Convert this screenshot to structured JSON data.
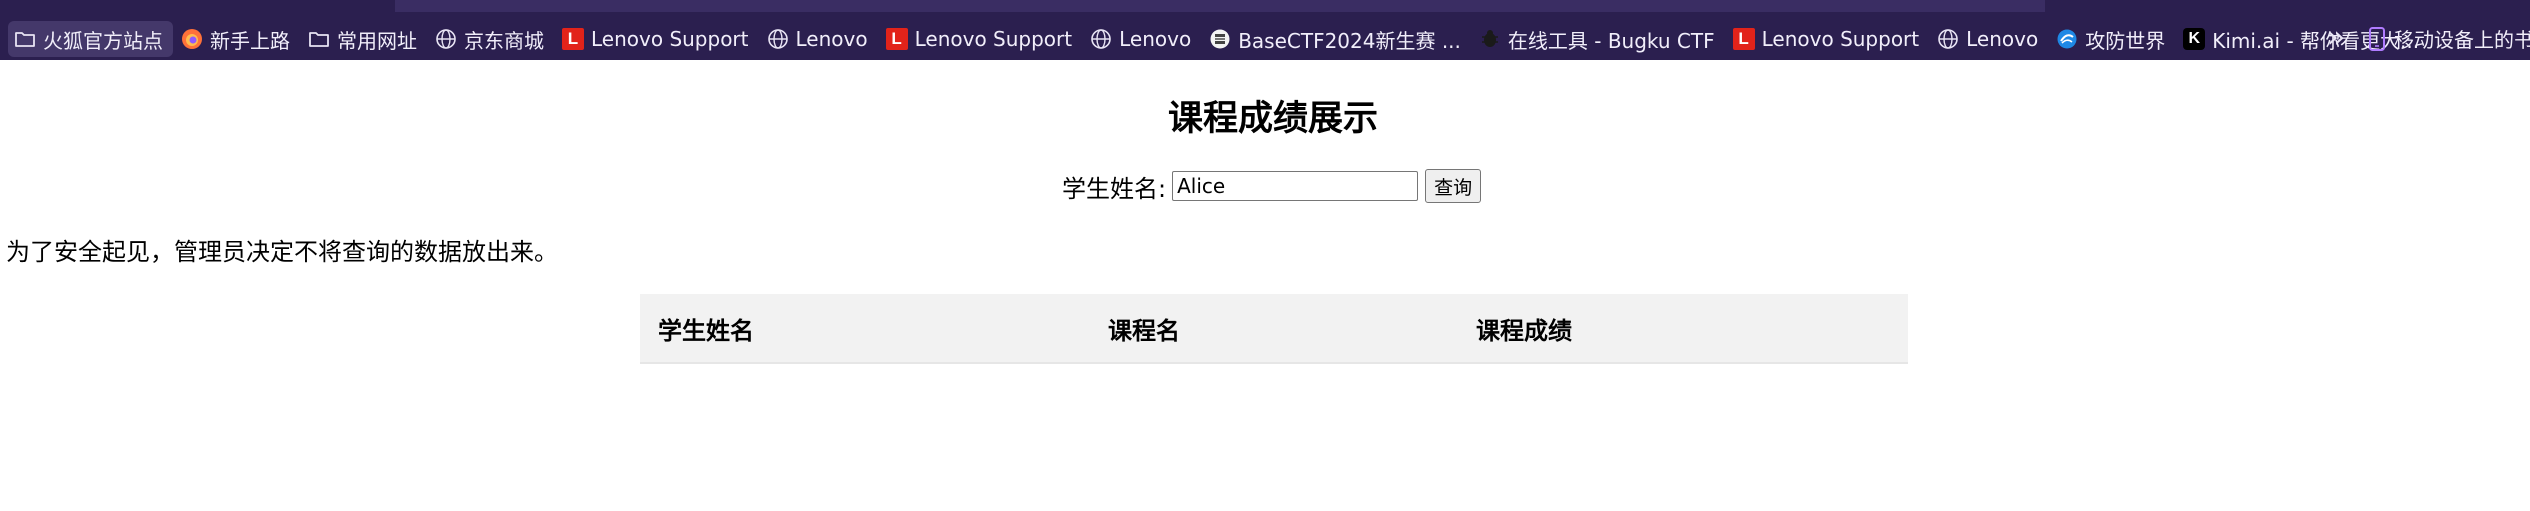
{
  "bookmarks_bar": {
    "items": [
      {
        "label": "火狐官方站点",
        "icon": "folder-icon"
      },
      {
        "label": "新手上路",
        "icon": "firefox-icon"
      },
      {
        "label": "常用网址",
        "icon": "folder-icon"
      },
      {
        "label": "京东商城",
        "icon": "globe-icon"
      },
      {
        "label": "Lenovo Support",
        "icon": "lenovo-icon"
      },
      {
        "label": "Lenovo",
        "icon": "globe-icon"
      },
      {
        "label": "Lenovo Support",
        "icon": "lenovo-icon"
      },
      {
        "label": "Lenovo",
        "icon": "globe-icon"
      },
      {
        "label": "BaseCTF2024新生赛 ...",
        "icon": "basectf-icon"
      },
      {
        "label": "在线工具 - Bugku CTF",
        "icon": "bugku-icon"
      },
      {
        "label": "Lenovo Support",
        "icon": "lenovo-icon"
      },
      {
        "label": "Lenovo",
        "icon": "globe-icon"
      },
      {
        "label": "攻防世界",
        "icon": "adworld-icon"
      },
      {
        "label": "Kimi.ai - 帮你看更大...",
        "icon": "kimi-icon"
      }
    ],
    "lenovo_glyph": "L",
    "kimi_glyph": "K",
    "overflow_glyph": "»",
    "mobile_label": "移动设备上的书签"
  },
  "page": {
    "title": "课程成绩展示",
    "search_label": "学生姓名:",
    "search_value": "Alice",
    "search_button": "查询",
    "notice": "为了安全起见，管理员决定不将查询的数据放出来。",
    "table_headers": [
      "学生姓名",
      "课程名",
      "课程成绩"
    ]
  },
  "colors": {
    "toolbar_bg": "#2b1f4f",
    "table_header_bg": "#f2f2f2",
    "lenovo_red": "#e2231a"
  }
}
